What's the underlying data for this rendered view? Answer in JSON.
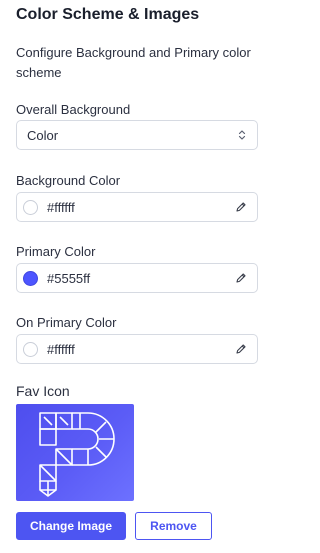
{
  "section": {
    "title": "Color Scheme & Images",
    "description": "Configure Background and Primary color scheme"
  },
  "overall_background": {
    "label": "Overall Background",
    "selected": "Color",
    "icon": "chevron-up-down-icon"
  },
  "background_color": {
    "label": "Background Color",
    "value": "#ffffff",
    "swatch": "#ffffff",
    "icon": "pencil-icon"
  },
  "primary_color": {
    "label": "Primary Color",
    "value": "#5555ff",
    "swatch": "#5555ff",
    "icon": "pencil-icon"
  },
  "on_primary_color": {
    "label": "On Primary Color",
    "value": "#ffffff",
    "swatch": "#ffffff",
    "icon": "pencil-icon"
  },
  "fav_icon": {
    "label": "Fav Icon",
    "gradient_start": "#4e4eee",
    "gradient_end": "#6d71ff"
  },
  "actions": {
    "change_label": "Change Image",
    "remove_label": "Remove",
    "accent": "#4d55f2"
  }
}
